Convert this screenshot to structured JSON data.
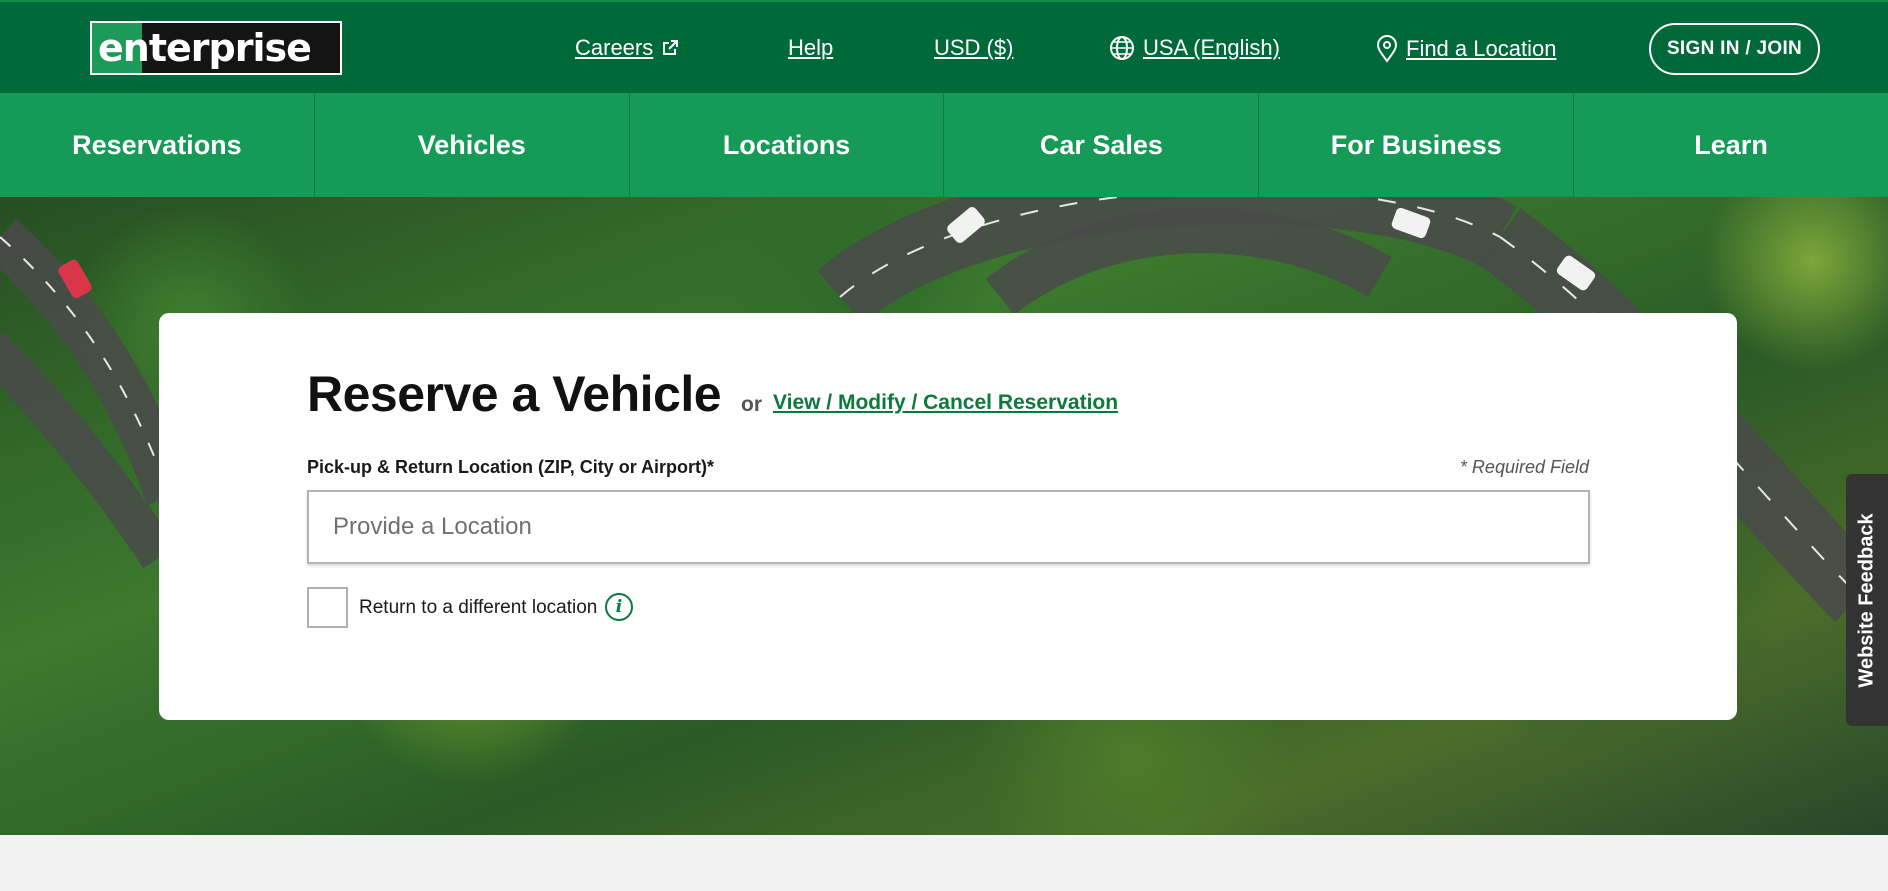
{
  "header": {
    "logo_text": "enterprise",
    "links": {
      "careers": "Careers",
      "help": "Help",
      "currency": "USD ($)",
      "language": "USA (English)",
      "find_location": "Find a Location"
    },
    "signin_label": "SIGN IN / JOIN",
    "icons": {
      "careers": "external-link-icon",
      "language": "globe-icon",
      "find_location": "map-pin-icon"
    }
  },
  "nav": {
    "items": [
      "Reservations",
      "Vehicles",
      "Locations",
      "Car Sales",
      "For Business",
      "Learn"
    ]
  },
  "reserve": {
    "title": "Reserve a Vehicle",
    "or": "or",
    "modify_link": "View / Modify / Cancel Reservation",
    "location_label": "Pick-up & Return Location (ZIP, City or Airport)*",
    "required_note": "* Required Field",
    "location_placeholder": "Provide a Location",
    "location_value": "",
    "return_different_label": "Return to a different location",
    "return_different_checked": false,
    "info_icon": "info-icon"
  },
  "feedback": {
    "label": "Website Feedback"
  },
  "colors": {
    "topbar": "#00693a",
    "nav": "#169a57",
    "link_green": "#0b7a3b",
    "feedback_tab": "#333333"
  }
}
